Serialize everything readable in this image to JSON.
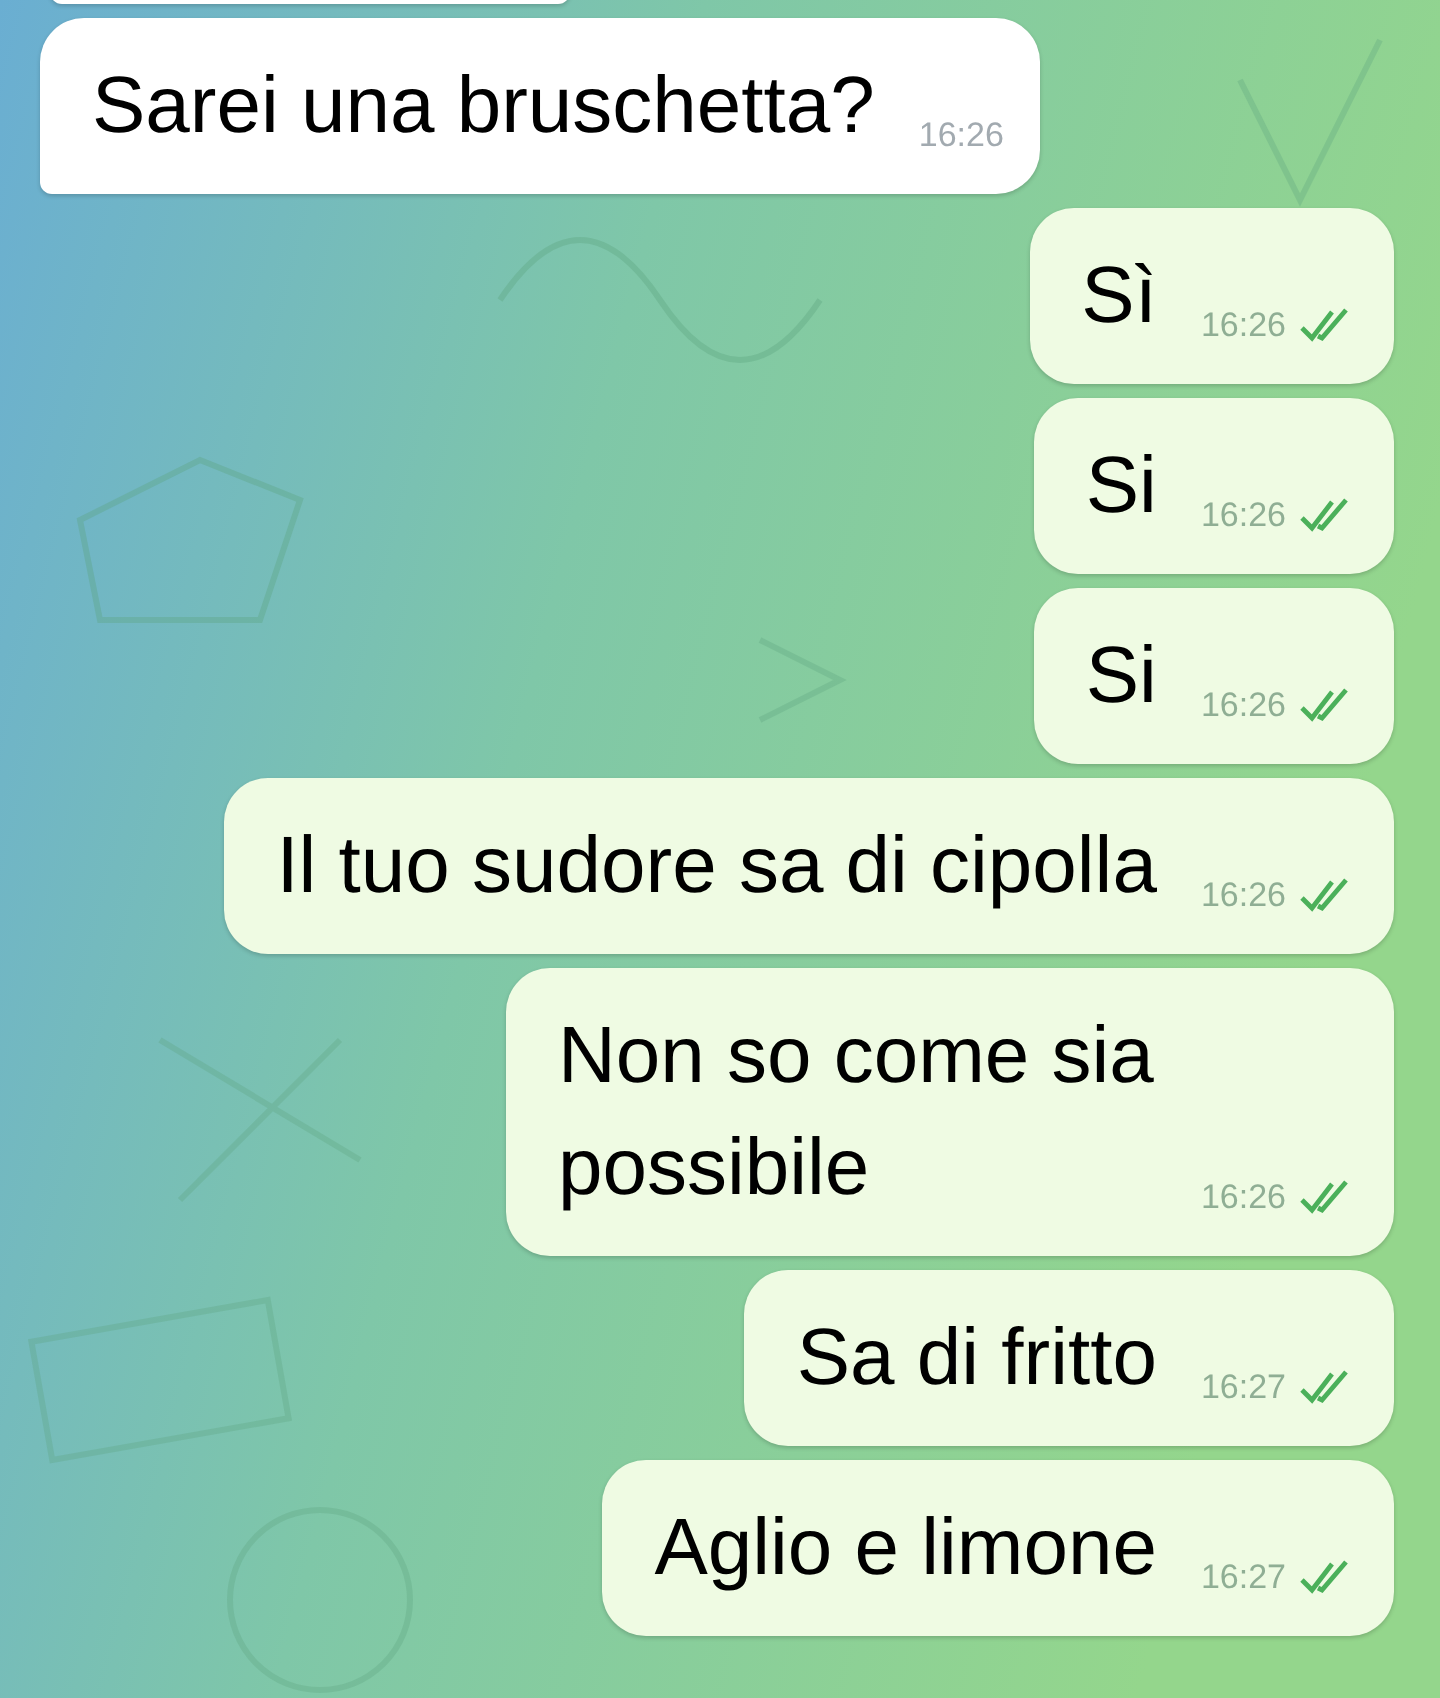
{
  "messages": [
    {
      "kind": "clipped"
    },
    {
      "kind": "incoming",
      "text": "Sarei una bruschetta?",
      "time": "16:26"
    },
    {
      "kind": "outgoing",
      "text": "Sì",
      "time": "16:26",
      "read": true
    },
    {
      "kind": "outgoing",
      "text": "Si",
      "time": "16:26",
      "read": true
    },
    {
      "kind": "outgoing",
      "text": "Si",
      "time": "16:26",
      "read": true
    },
    {
      "kind": "outgoing",
      "text": "Il tuo sudore sa di cipolla",
      "time": "16:26",
      "read": true
    },
    {
      "kind": "outgoing",
      "text": "Non so come sia possibile",
      "time": "16:26",
      "read": true
    },
    {
      "kind": "outgoing",
      "text": "Sa di fritto",
      "time": "16:27",
      "read": true
    },
    {
      "kind": "outgoing",
      "text": "Aglio e limone",
      "time": "16:27",
      "read": true
    }
  ]
}
